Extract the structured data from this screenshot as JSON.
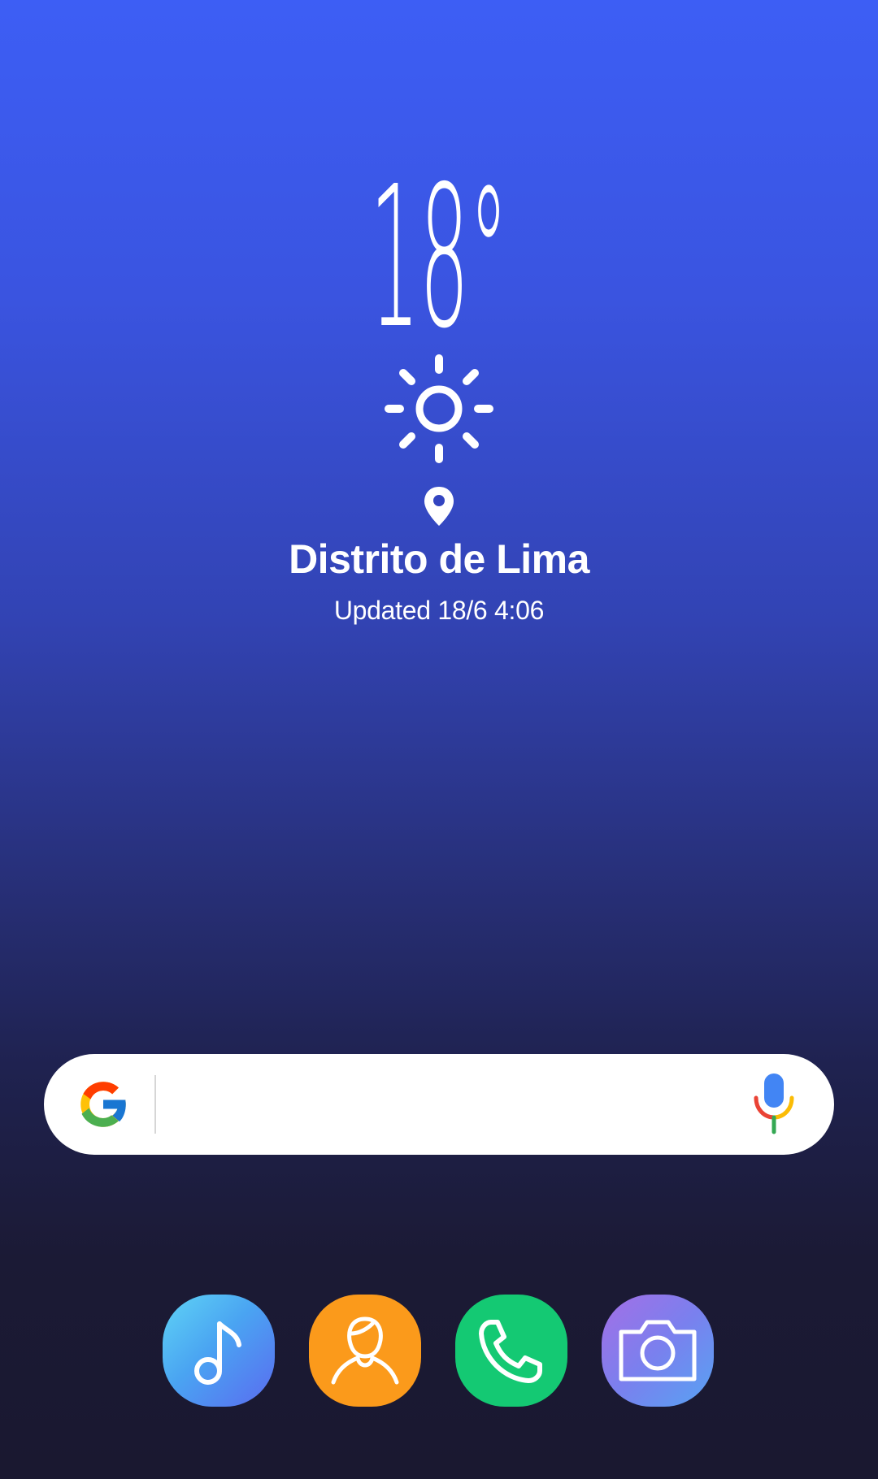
{
  "weather": {
    "temperature": "18°",
    "condition_icon": "sun-icon",
    "location_icon": "location-pin-icon",
    "location": "Distrito de Lima",
    "updated": "Updated 18/6  4:06"
  },
  "search_bar": {
    "logo_icon": "google-g-icon",
    "voice_icon": "mic-icon",
    "placeholder": ""
  },
  "dock": {
    "apps": [
      {
        "name": "Music",
        "icon": "music-note-icon",
        "color": "#4aa4f2"
      },
      {
        "name": "Contacts",
        "icon": "contacts-icon",
        "color": "#fb9a1b"
      },
      {
        "name": "Phone",
        "icon": "phone-icon",
        "color": "#14c973"
      },
      {
        "name": "Camera",
        "icon": "camera-icon",
        "color": "#7a80ee"
      }
    ]
  },
  "colors": {
    "background_top": "#3d5ef5",
    "background_bottom": "#1a1830"
  }
}
